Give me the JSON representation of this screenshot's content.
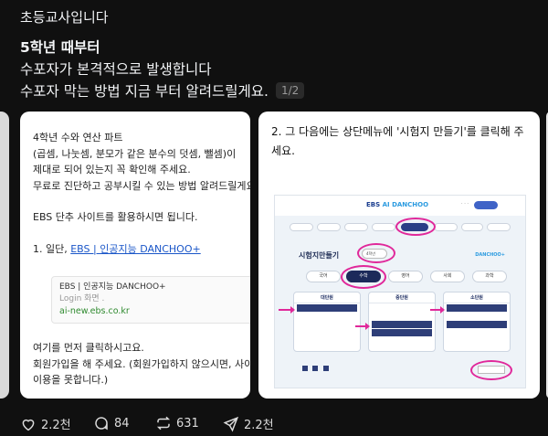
{
  "post": {
    "author": "초등교사입니다",
    "lines": [
      "5학년 때부터",
      "수포자가 본격적으로 발생합니다",
      "수포자 막는 방법 지금 부터 알려드릴게요."
    ],
    "pager": "1/2"
  },
  "card1": {
    "lines_top": [
      "4학년 수와 연산 파트",
      " (곱셈, 나눗셈, 분모가 같은 분수의 덧셈, 뺄셈)이",
      "제대로 되어 있는지 꼭 확인해 주세요.",
      "무료로 진단하고 공부시킬 수 있는 방법 알려드릴게요."
    ],
    "line_ebs": "EBS 단추 사이트를 활용하시면 됩니다.",
    "step1_prefix": "1. 일단, ",
    "step1_link": "EBS | 인공지능 DANCHOO+",
    "link_preview": {
      "title": "EBS | 인공지능 DANCHOO+",
      "subtitle": "Login 화면 .",
      "domain": "ai-new.ebs.co.kr"
    },
    "lines_bottom": [
      "여기를 먼저 클릭하시고요.",
      "회원가입을 해 주세요. (회원가입하지 않으시면, 사이트",
      "이용을 못합니다.)"
    ]
  },
  "card2": {
    "lines": [
      "2. 그 다음에는 상단메뉴에 '시험지 만들기'를 클릭해 주",
      "세요."
    ],
    "screenshot": {
      "logo_a": "EBS",
      "logo_b": "AI DANCHOO",
      "title": "시험지만들기",
      "grade": "4학년",
      "brand": "DANCHOO+",
      "subjects": [
        "국어",
        "수학",
        "영어",
        "사회",
        "과학"
      ],
      "categories": [
        "대단원",
        "중단원",
        "소단원"
      ]
    }
  },
  "actions": {
    "likes": "2.2천",
    "comments": "84",
    "reposts": "631",
    "shares": "2.2천"
  },
  "colors": {
    "background": "#101010",
    "text": "#f3f5f7",
    "highlight": "#e0289a"
  }
}
